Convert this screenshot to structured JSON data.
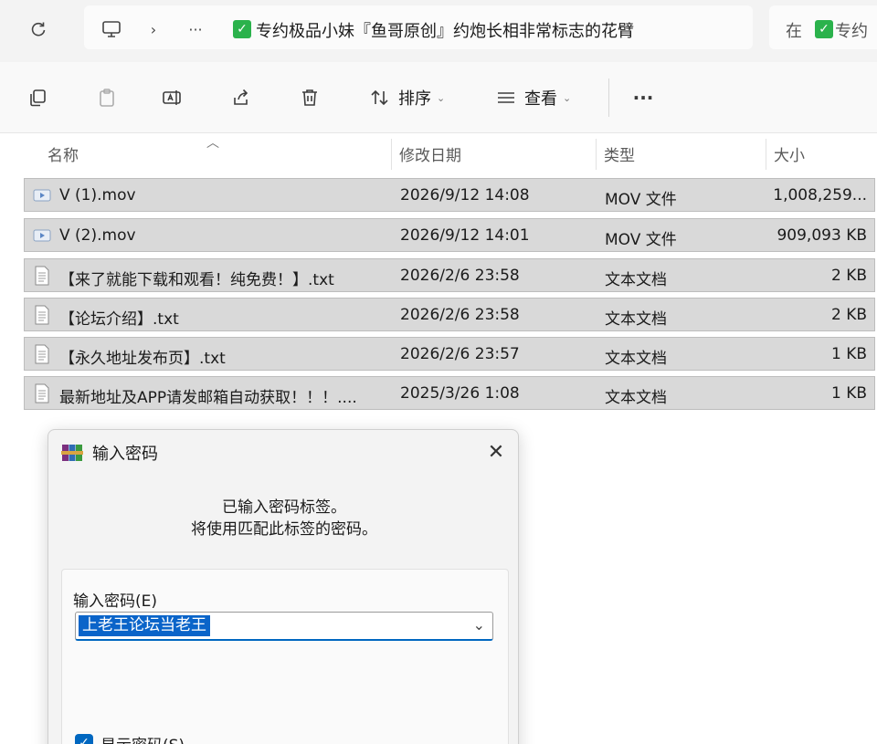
{
  "address_bar": {
    "breadcrumb_more": "···",
    "folder_name": "专约极品小妹『鱼哥原创』约炮长相非常标志的花臂",
    "search_prefix": "在",
    "search_tail": "专约"
  },
  "toolbar": {
    "sort_label": "排序",
    "view_label": "查看",
    "more_label": "···"
  },
  "columns": {
    "name": "名称",
    "date": "修改日期",
    "type": "类型",
    "size": "大小"
  },
  "files": [
    {
      "icon": "video-file-icon",
      "name": "V (1).mov",
      "date": "2026/9/12 14:08",
      "type": "MOV 文件",
      "size": "1,008,259..."
    },
    {
      "icon": "video-file-icon",
      "name": "V (2).mov",
      "date": "2026/9/12 14:01",
      "type": "MOV 文件",
      "size": "909,093 KB"
    },
    {
      "icon": "text-file-icon",
      "name": "【来了就能下载和观看！纯免费！】.txt",
      "date": "2026/2/6 23:58",
      "type": "文本文档",
      "size": "2 KB"
    },
    {
      "icon": "text-file-icon",
      "name": "【论坛介绍】.txt",
      "date": "2026/2/6 23:58",
      "type": "文本文档",
      "size": "2 KB"
    },
    {
      "icon": "text-file-icon",
      "name": "【永久地址发布页】.txt",
      "date": "2026/2/6 23:57",
      "type": "文本文档",
      "size": "1 KB"
    },
    {
      "icon": "text-file-icon",
      "name": "最新地址及APP请发邮箱自动获取！！！....",
      "date": "2025/3/26 1:08",
      "type": "文本文档",
      "size": "1 KB"
    }
  ],
  "dialog": {
    "title": "输入密码",
    "message_line1": "已输入密码标签。",
    "message_line2": "将使用匹配此标签的密码。",
    "password_label": "输入密码(E)",
    "password_value": "上老王论坛当老王",
    "show_password_label": "显示密码(S)",
    "show_password_checked": true
  },
  "colors": {
    "selection": "#d9d9d9",
    "accent": "#0067c0",
    "check_green": "#2bb24c"
  }
}
